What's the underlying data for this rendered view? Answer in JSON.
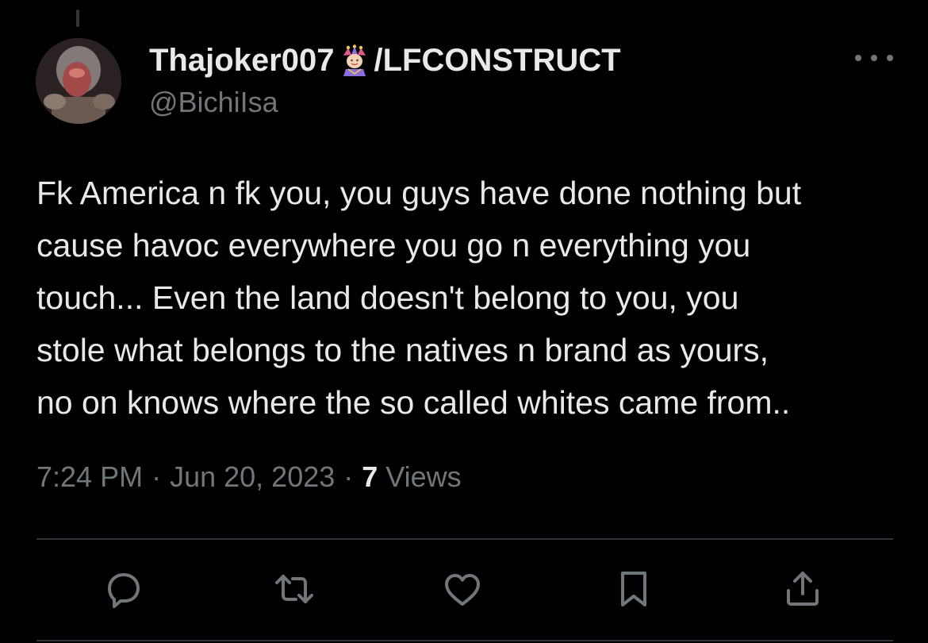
{
  "tweet": {
    "author": {
      "display_name_part1": "Thajoker007",
      "display_name_emoji": "jester-icon",
      "display_name_part2": "/LFCONSTRUCT",
      "handle": "@BichiIsa"
    },
    "text_lines": [
      "Fk America n fk you, you guys have done nothing but",
      "cause havoc everywhere you go n everything you",
      "touch... Even the land doesn't belong to you, you",
      "stole what belongs to the natives n brand as yours,",
      "no on knows where the so called whites came from.."
    ],
    "time": "7:24 PM",
    "separator": "·",
    "date": "Jun 20, 2023",
    "views_count": "7",
    "views_label": "Views"
  },
  "actions": [
    {
      "icon": "reply-icon"
    },
    {
      "icon": "retweet-icon"
    },
    {
      "icon": "like-icon"
    },
    {
      "icon": "bookmark-icon"
    },
    {
      "icon": "share-icon"
    }
  ],
  "colors": {
    "background": "#000000",
    "primary_text": "#e7e9ea",
    "secondary_text": "#71767b",
    "divider": "#2f3336"
  }
}
